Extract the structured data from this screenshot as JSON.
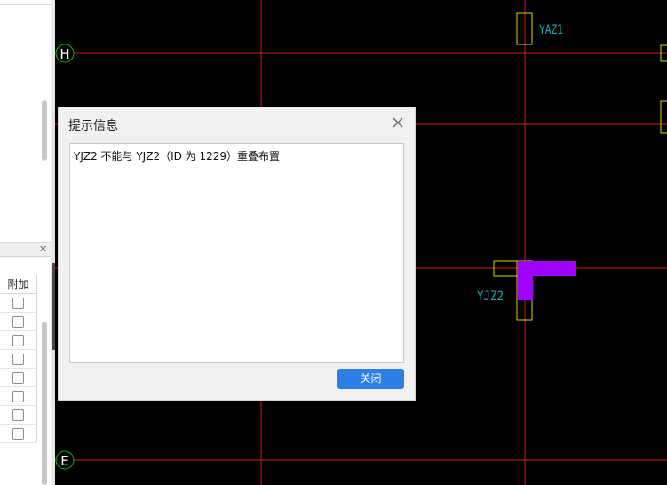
{
  "left_panel": {
    "column_header": "附加",
    "checkboxes": [
      false,
      false,
      false,
      false,
      false,
      false,
      false,
      false
    ]
  },
  "canvas": {
    "axis_labels": [
      "H",
      "E"
    ],
    "components": [
      {
        "label": "YAZ1"
      },
      {
        "label": "YJZ2"
      }
    ],
    "colors": {
      "background": "#000000",
      "grid_line": "#d01a1a",
      "axis_bubble": "#00c000",
      "component_outline": "#d6d600",
      "label_text": "#1aa6b0",
      "highlight": "#a000ff"
    }
  },
  "dialog": {
    "title": "提示信息",
    "message": "YJZ2 不能与 YJZ2（ID 为 1229）重叠布置",
    "close_button_label": "关闭",
    "accent_color": "#2d7fe6"
  }
}
